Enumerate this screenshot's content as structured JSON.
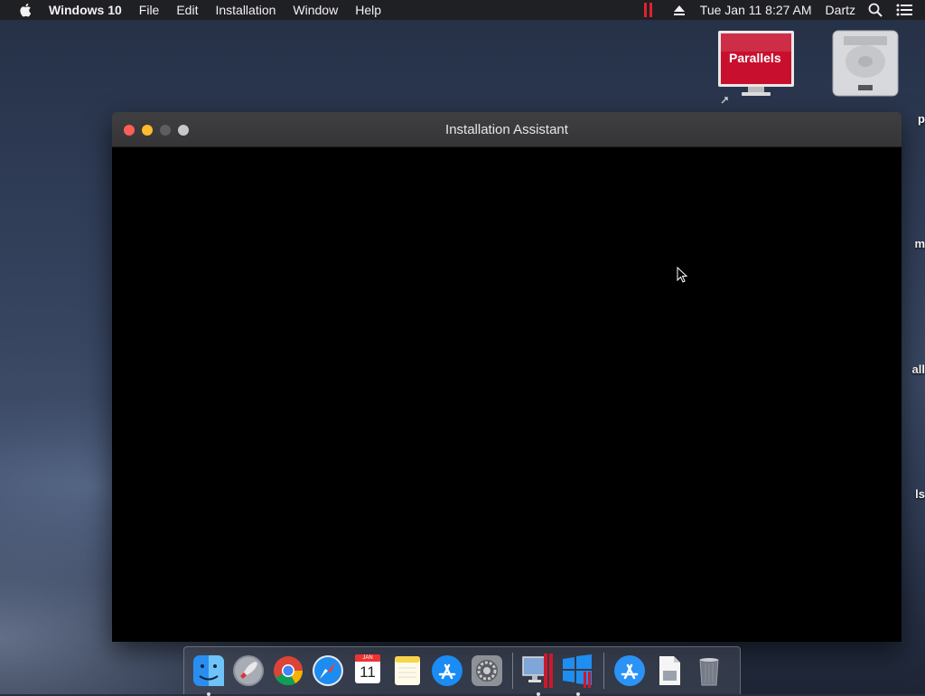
{
  "menubar": {
    "app_name": "Windows 10",
    "menus": [
      "File",
      "Edit",
      "Installation",
      "Window",
      "Help"
    ],
    "clock": "Tue Jan 11  8:27 AM",
    "username": "Dartz"
  },
  "desktop": {
    "parallels_badge": "Parallels",
    "edge_labels": [
      "p",
      "m",
      "all",
      "ls"
    ]
  },
  "window": {
    "title": "Installation Assistant"
  },
  "dock": {
    "calendar_month": "JAN",
    "calendar_day": "11"
  },
  "colors": {
    "close": "#ff5f57",
    "minimize": "#febc2e",
    "parallels_red": "#e0222b"
  }
}
